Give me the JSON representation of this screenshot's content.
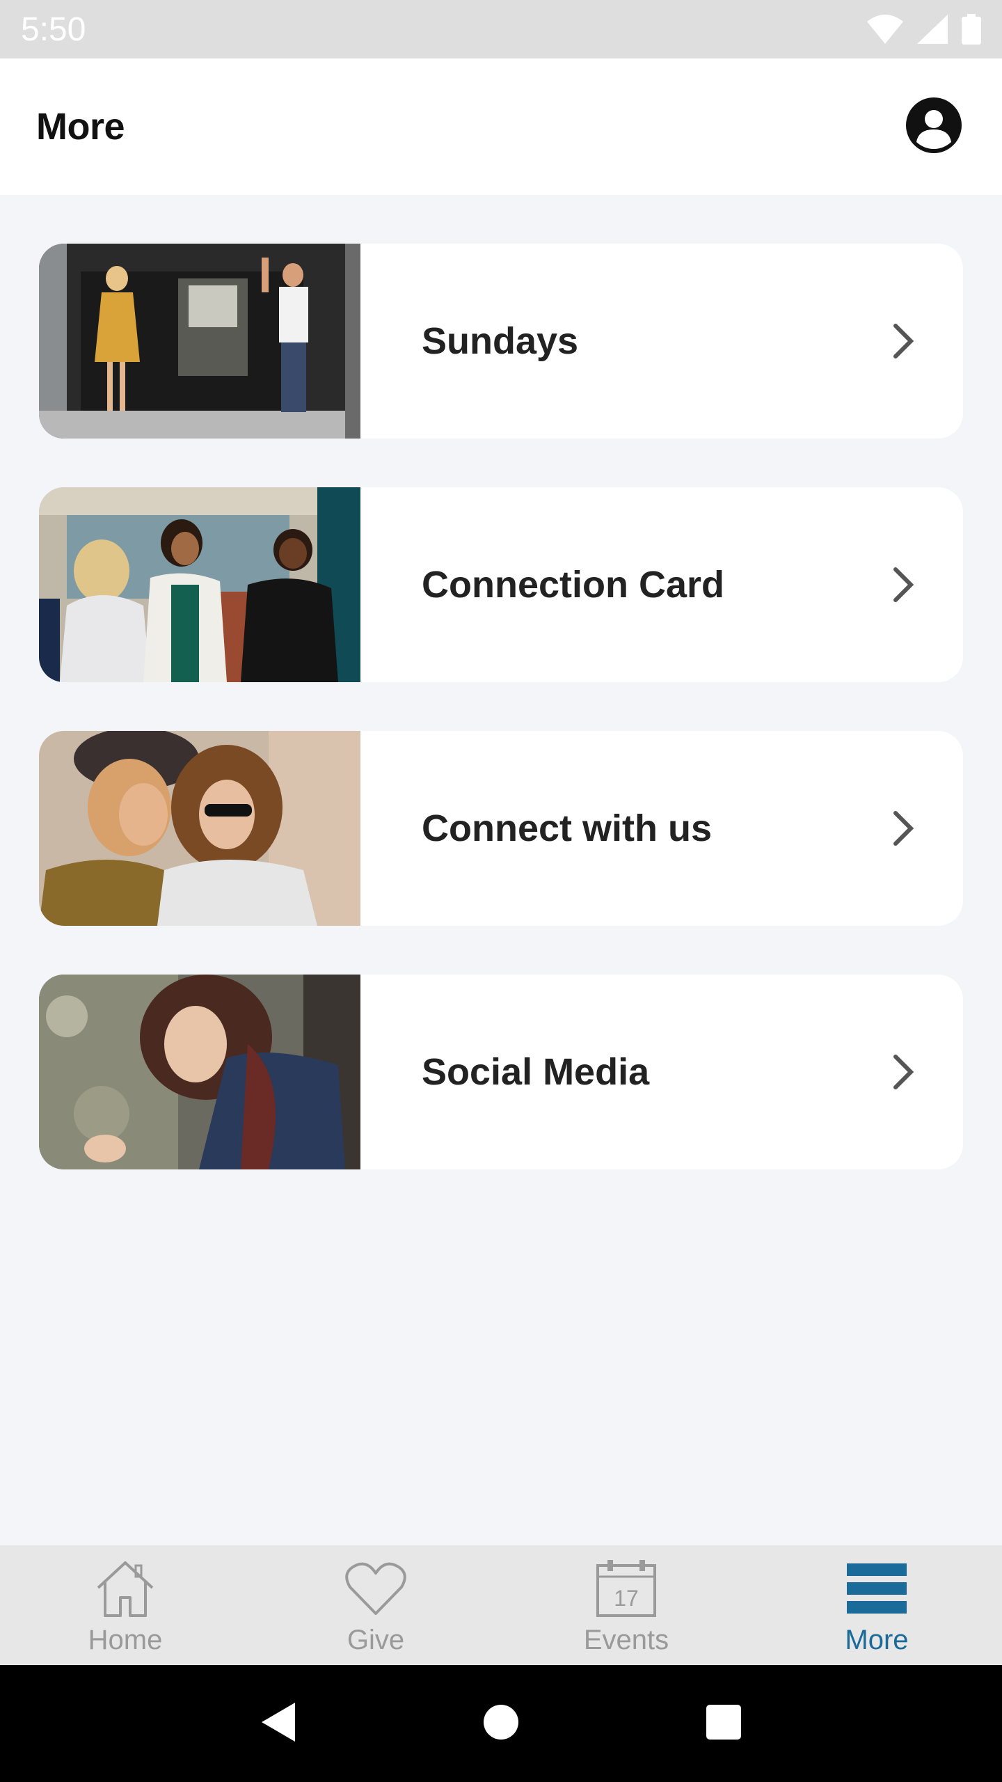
{
  "status_bar": {
    "time": "5:50",
    "icons": [
      "wifi-icon",
      "cell-signal-icon",
      "battery-icon"
    ]
  },
  "header": {
    "title": "More",
    "profile_icon": "user-circle-icon"
  },
  "list": {
    "items": [
      {
        "label": "Sundays",
        "thumbnail": "two people waving at church entrance",
        "chevron": "chevron-right-icon"
      },
      {
        "label": "Connection Card",
        "thumbnail": "women talking in lobby",
        "chevron": "chevron-right-icon"
      },
      {
        "label": "Connect with us",
        "thumbnail": "two friends laughing outdoors",
        "chevron": "chevron-right-icon"
      },
      {
        "label": "Social Media",
        "thumbnail": "young woman looking at phone",
        "chevron": "chevron-right-icon"
      }
    ]
  },
  "bottom_nav": {
    "items": [
      {
        "label": "Home",
        "icon": "home-icon",
        "active": false
      },
      {
        "label": "Give",
        "icon": "heart-icon",
        "active": false
      },
      {
        "label": "Events",
        "icon": "calendar-icon",
        "calendar_day": "17",
        "active": false
      },
      {
        "label": "More",
        "icon": "menu-icon",
        "active": true
      }
    ]
  },
  "colors": {
    "accent": "#1a6a9a",
    "inactive": "#9a9a9a",
    "background": "#f3f5f9",
    "card": "#ffffff",
    "status_bar": "#dedede",
    "nav_bar": "#e7e7e7"
  }
}
